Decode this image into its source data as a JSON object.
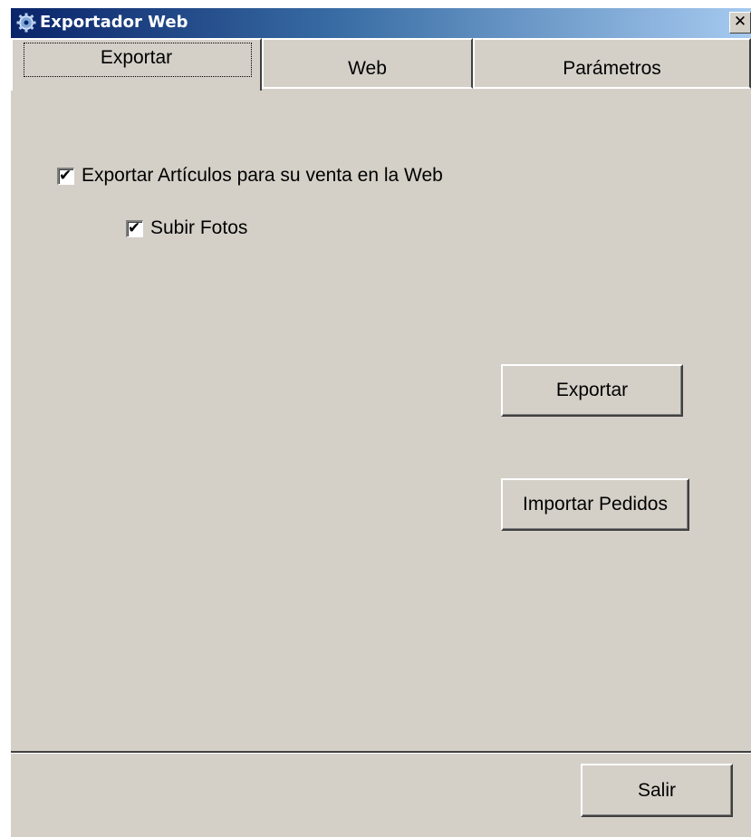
{
  "window": {
    "title": "Exportador Web",
    "close_glyph": "✕"
  },
  "icons": {
    "app": "gear-icon",
    "close": "close-icon",
    "check": "checkmark-icon"
  },
  "colors": {
    "title_start": "#0a246a",
    "title_end": "#a6caf0",
    "face": "#d4d0c8"
  },
  "tabs": [
    {
      "label": "Exportar",
      "active": true
    },
    {
      "label": "Web",
      "active": false
    },
    {
      "label": "Parámetros",
      "active": false
    }
  ],
  "export_tab": {
    "export_articles": {
      "label": "Exportar Artículos para su venta en la Web",
      "checked": true
    },
    "upload_photos": {
      "label": "Subir Fotos",
      "checked": true
    },
    "export_button": "Exportar",
    "import_orders_button": "Importar Pedidos"
  },
  "footer": {
    "exit_button": "Salir"
  }
}
